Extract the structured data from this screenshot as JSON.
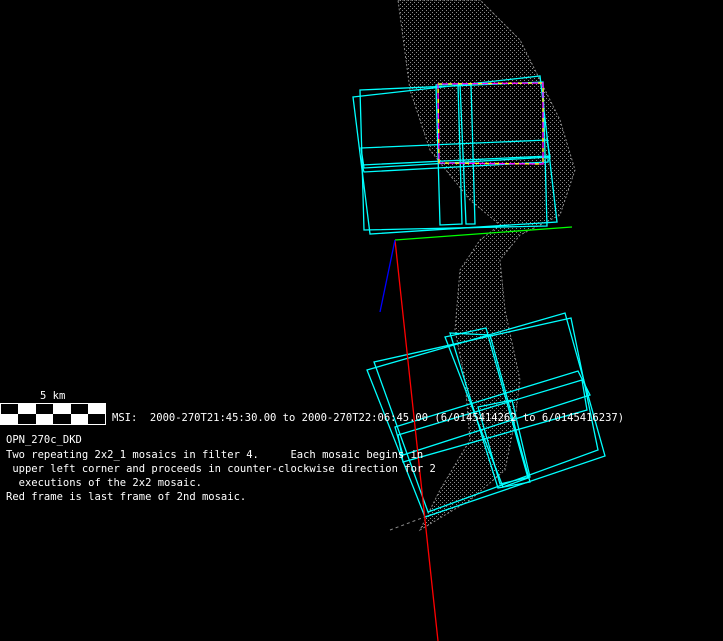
{
  "scale_bar": {
    "label": "5 km"
  },
  "msi_line": "MSI:  2000-270T21:45:30.00 to 2000-270T22:06:45.00 (6/0145414262 to 6/0145416237)",
  "observation_id": "OPN_270c_DKD",
  "description": [
    "Two repeating 2x2_1 mosaics in filter 4.     Each mosaic begins in",
    " upper left corner and proceeds in counter-clockwise direction for 2",
    "  executions of the 2x2 mosaic.",
    "Red frame is last frame of 2nd mosaic."
  ],
  "colors": {
    "frame": "#00ffff",
    "red_axis": "#ff0000",
    "green_axis": "#00ff00",
    "blue_axis": "#0000ff",
    "asteroid": "#8c8c8c",
    "highlight_a": "#ff00ff",
    "highlight_b": "#ffff00"
  }
}
